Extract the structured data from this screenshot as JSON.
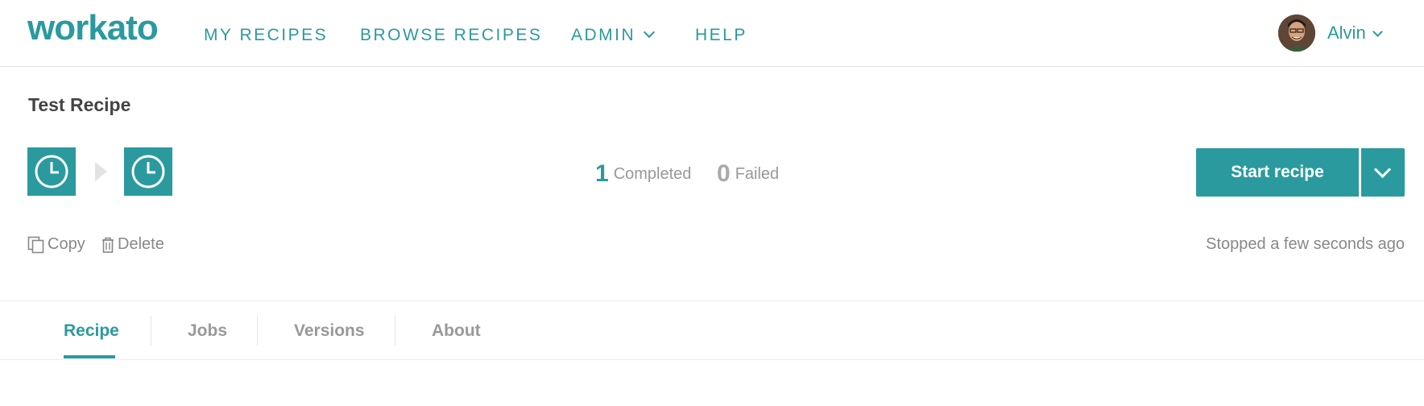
{
  "brand": {
    "logo": "workato",
    "accent": "#2b9a9e"
  },
  "nav": {
    "items": [
      {
        "label": "MY RECIPES"
      },
      {
        "label": "BROWSE RECIPES"
      },
      {
        "label": "ADMIN"
      },
      {
        "label": "HELP"
      }
    ],
    "user": {
      "name": "Alvin",
      "icon": "user-avatar"
    }
  },
  "recipe": {
    "title": "Test Recipe",
    "steps": [
      {
        "icon": "clock-icon"
      },
      {
        "icon": "clock-icon"
      }
    ],
    "stats": {
      "completed_count": "1",
      "completed_label": "Completed",
      "failed_count": "0",
      "failed_label": "Failed"
    },
    "start_label": "Start recipe",
    "actions": {
      "copy": "Copy",
      "delete": "Delete"
    },
    "status": "Stopped a few seconds ago"
  },
  "tabs": [
    {
      "label": "Recipe",
      "active": true
    },
    {
      "label": "Jobs"
    },
    {
      "label": "Versions"
    },
    {
      "label": "About"
    }
  ]
}
